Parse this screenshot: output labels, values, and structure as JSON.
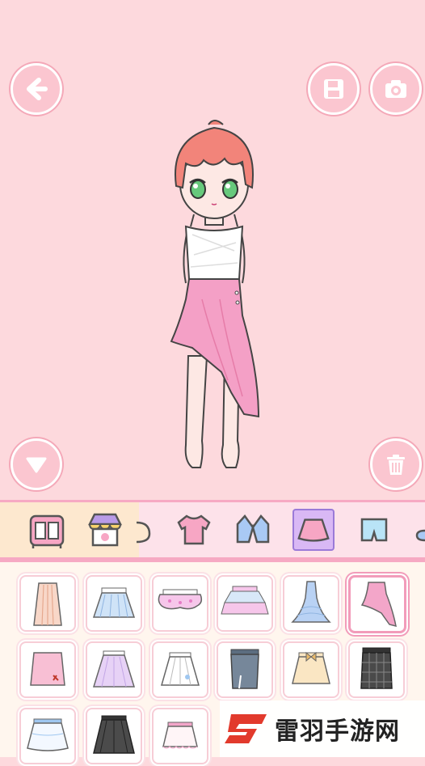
{
  "toolbar": {
    "back_icon": "arrow-left-icon",
    "save_icon": "floppy-disk-icon",
    "camera_icon": "camera-icon",
    "collapse_icon": "triangle-down-icon",
    "delete_icon": "trash-icon"
  },
  "categories": [
    {
      "icon": "wardrobe-icon"
    },
    {
      "icon": "shop-icon"
    },
    {
      "icon": "hat-icon"
    },
    {
      "icon": "shirt-icon"
    },
    {
      "icon": "jacket-icon"
    },
    {
      "icon": "skirt-icon",
      "selected": true
    },
    {
      "icon": "shorts-icon"
    },
    {
      "icon": "shoe-icon"
    }
  ],
  "items": [
    {
      "kind": "long-pleated-skirt",
      "color": "#f8d7c8"
    },
    {
      "kind": "pleated-skirt-blue",
      "color": "#cfe3f7"
    },
    {
      "kind": "tutu-skirt-pink",
      "color": "#f6c6ea"
    },
    {
      "kind": "tiered-tutu-pastel",
      "color": "#d8e8f8"
    },
    {
      "kind": "mermaid-skirt-blue",
      "color": "#b9d2f4"
    },
    {
      "kind": "asymmetric-ruffle-skirt-pink",
      "color": "#f3a6c9",
      "selected": true
    },
    {
      "kind": "pink-wrap-skirt",
      "color": "#f8bfd4"
    },
    {
      "kind": "lavender-skirt",
      "color": "#e7d2f6"
    },
    {
      "kind": "white-pleated-skirt",
      "color": "#ffffff"
    },
    {
      "kind": "grey-slit-pencil-skirt",
      "color": "#76879a"
    },
    {
      "kind": "cream-bow-skirt",
      "color": "#fae6c3"
    },
    {
      "kind": "black-plaid-skirt",
      "color": "#4a4a4a"
    },
    {
      "kind": "white-ruffle-skirt",
      "color": "#f3f8ff"
    },
    {
      "kind": "black-pleated-skirt",
      "color": "#4b4b4b"
    },
    {
      "kind": "white-lace-skirt",
      "color": "#fff5f7"
    }
  ],
  "watermark": {
    "text": "雷羽手游网"
  },
  "colors": {
    "background": "#fdd9dd",
    "accent": "#f6a9c3",
    "button": "#fbc6d0"
  }
}
